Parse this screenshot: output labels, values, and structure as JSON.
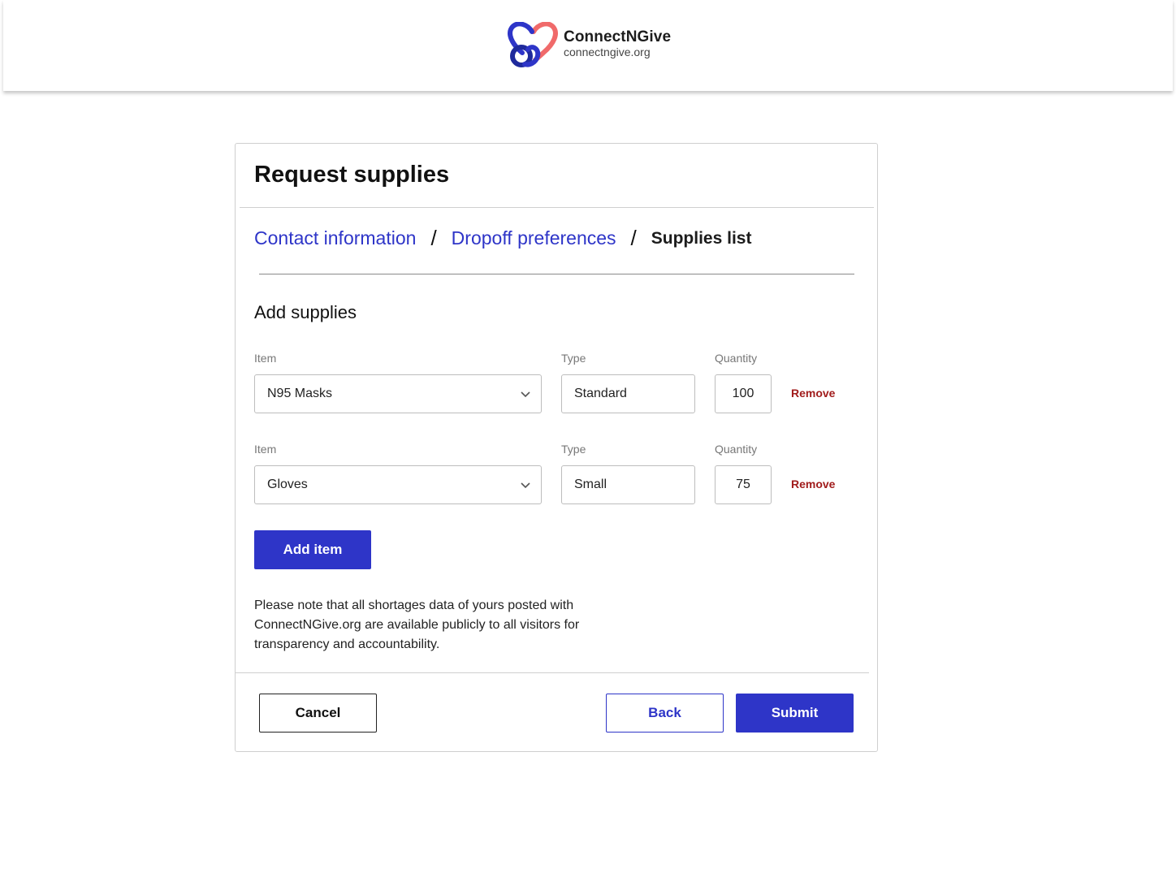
{
  "header": {
    "brand_name": "ConnectNGive",
    "brand_url": "connectngive.org",
    "colors": {
      "blue": "#2e35c8",
      "coral": "#f06a6a",
      "navy": "#1f2a9c"
    }
  },
  "form": {
    "title": "Request supplies",
    "breadcrumb": [
      {
        "label": "Contact information"
      },
      {
        "label": "Dropoff preferences"
      },
      {
        "label": "Supplies list"
      }
    ],
    "separator": "/",
    "section_title": "Add supplies",
    "labels": {
      "item": "Item",
      "type": "Type",
      "quantity": "Quantity"
    },
    "rows": [
      {
        "item": "N95 Masks",
        "type": "Standard",
        "quantity": "100",
        "remove_label": "Remove"
      },
      {
        "item": "Gloves",
        "type": "Small",
        "quantity": "75",
        "remove_label": "Remove"
      }
    ],
    "add_item_label": "Add item",
    "note": "Please note that all shortages data of yours posted with ConnectNGive.org are available publicly to all visitors for transparency and accountability.",
    "buttons": {
      "cancel": "Cancel",
      "back": "Back",
      "submit": "Submit"
    },
    "accent_color": "#2e35c8",
    "remove_color": "#a11c1c"
  }
}
